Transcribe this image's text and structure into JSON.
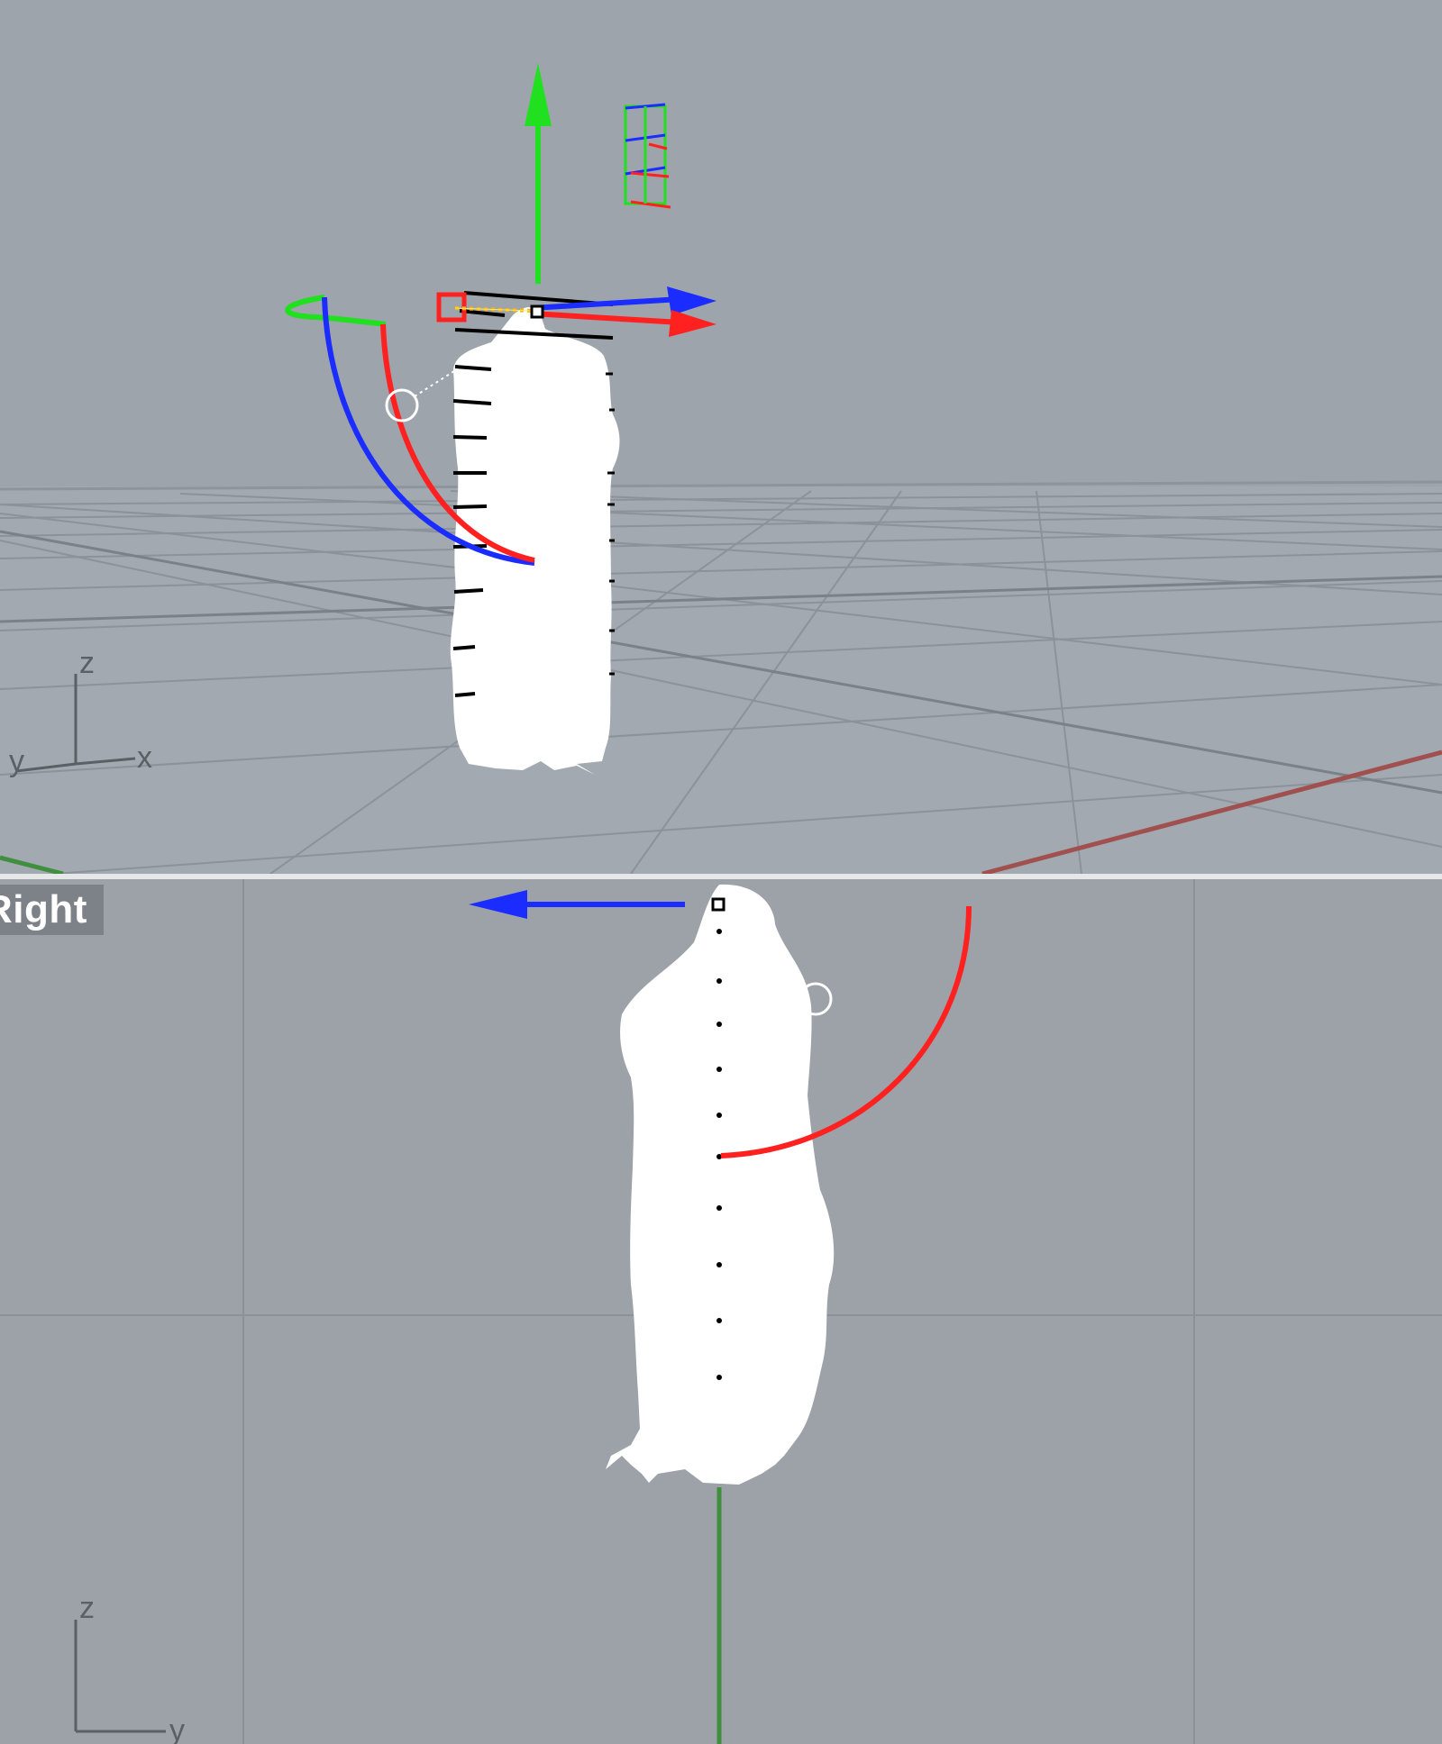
{
  "viewports": {
    "perspective": {
      "axis_labels": {
        "z": "z",
        "y": "y",
        "x": "x"
      }
    },
    "right": {
      "title": "Right",
      "axis_labels": {
        "z": "z",
        "y": "y"
      }
    }
  },
  "colors": {
    "background": "#9ea4ab",
    "grid": "#8d939b",
    "grid_major": "#7e848c",
    "model": "#ffffff",
    "gizmo_x": "#ff2020",
    "gizmo_y": "#20e020",
    "gizmo_z": "#1a2cff",
    "world_x_axis": "#a0504f",
    "world_y_axis": "#3f8f3f"
  },
  "icons": [
    "move-gizmo-icon",
    "rotate-gizmo-icon",
    "scale-gizmo-icon",
    "world-axis-icon"
  ]
}
